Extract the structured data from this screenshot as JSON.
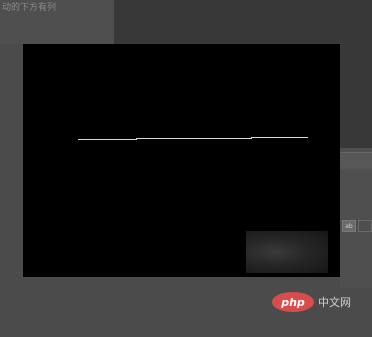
{
  "background": {
    "caption": "动的下方有列"
  },
  "side_panel": {
    "field_label": "ab"
  },
  "watermark": {
    "logo_text": "php",
    "site_text": "中文网"
  },
  "colors": {
    "canvas": "#000000",
    "stroke": "#d9d9d9",
    "watermark_logo": "#d84c4c"
  }
}
